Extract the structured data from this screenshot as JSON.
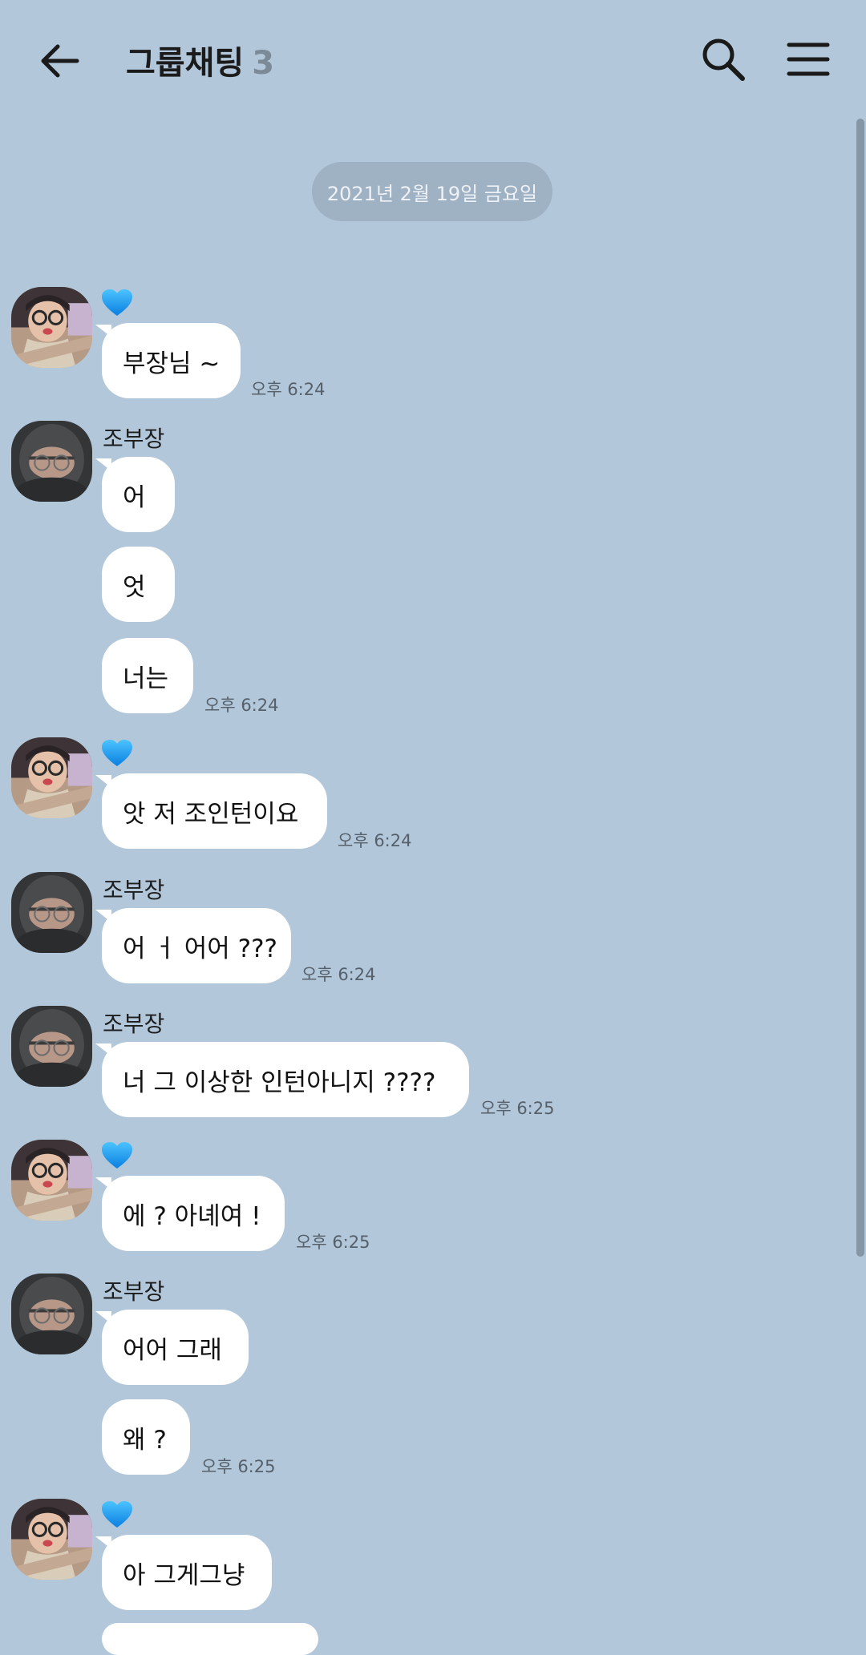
{
  "header": {
    "title": "그룹채팅",
    "member_count": "3"
  },
  "date_divider": "2021년 2월 19일 금요일",
  "senders": {
    "other": "조부장"
  },
  "messages": [
    {
      "text": "부장님 ~",
      "time": "오후 6:24"
    },
    {
      "text": "어"
    },
    {
      "text": "엇"
    },
    {
      "text": "너는",
      "time": "오후 6:24"
    },
    {
      "text": "앗 저 조인턴이요",
      "time": "오후 6:24"
    },
    {
      "text": "어 ㅓ 어어 ???",
      "time": "오후 6:24"
    },
    {
      "text": "너 그 이상한 인턴아니지 ????",
      "time": "오후 6:25"
    },
    {
      "text": "에 ? 아녜여 !",
      "time": "오후 6:25"
    },
    {
      "text": "어어 그래"
    },
    {
      "text": "왜 ?",
      "time": "오후 6:25"
    },
    {
      "text": "아 그게그냥"
    }
  ],
  "colors": {
    "background": "#b2c7da",
    "bubble": "#ffffff",
    "heart": "#1e9bf0"
  },
  "icons": [
    "back-arrow-icon",
    "search-icon",
    "hamburger-menu-icon",
    "blue-heart-icon"
  ]
}
